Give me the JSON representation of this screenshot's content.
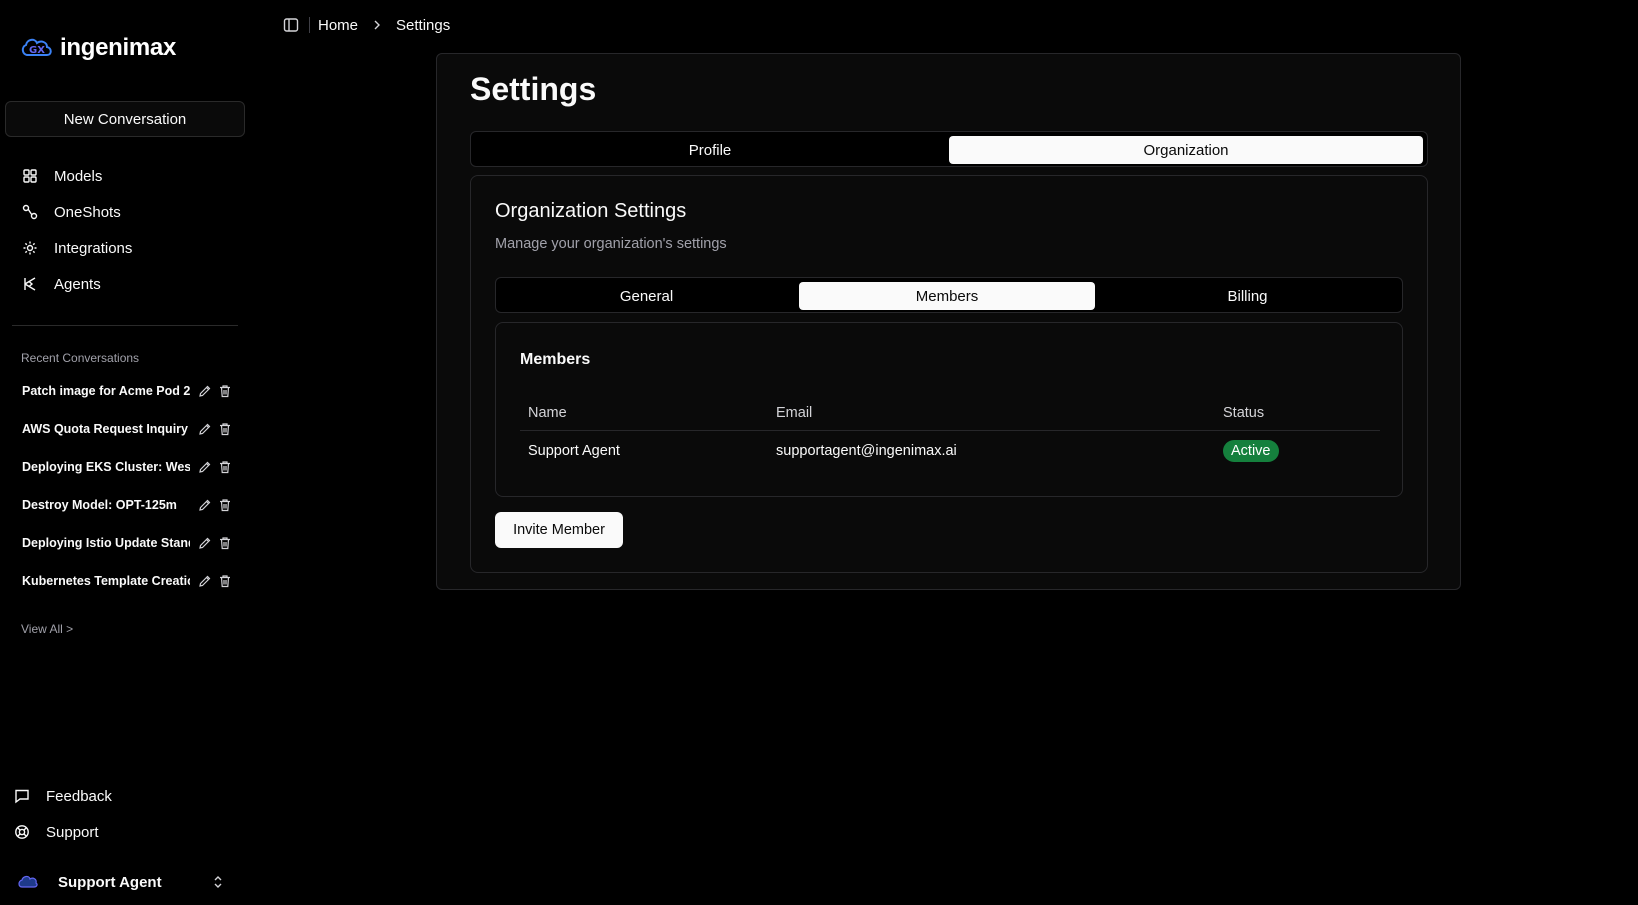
{
  "brand": {
    "name": "ingenimax"
  },
  "sidebar": {
    "new_conversation": "New Conversation",
    "nav": [
      {
        "label": "Models",
        "icon": "models-icon"
      },
      {
        "label": "OneShots",
        "icon": "oneshots-icon"
      },
      {
        "label": "Integrations",
        "icon": "integrations-icon"
      },
      {
        "label": "Agents",
        "icon": "agents-icon"
      }
    ],
    "recent_title": "Recent Conversations",
    "recent": [
      {
        "label": "Patch image for Acme Pod 2"
      },
      {
        "label": "AWS Quota Request Inquiry"
      },
      {
        "label": "Deploying EKS Cluster: West"
      },
      {
        "label": "Destroy Model: OPT-125m"
      },
      {
        "label": "Deploying Istio Update Standard"
      },
      {
        "label": "Kubernetes Template Creation"
      }
    ],
    "view_all": "View All >",
    "bottom": [
      {
        "label": "Feedback",
        "icon": "feedback-icon"
      },
      {
        "label": "Support",
        "icon": "support-icon"
      }
    ],
    "user": {
      "name": "Support Agent"
    }
  },
  "breadcrumb": {
    "home": "Home",
    "current": "Settings"
  },
  "settings": {
    "title": "Settings",
    "tabs": {
      "profile": "Profile",
      "organization": "Organization"
    },
    "active_tab": "Organization",
    "org": {
      "title": "Organization Settings",
      "subtitle": "Manage your organization's settings",
      "tabs": {
        "general": "General",
        "members": "Members",
        "billing": "Billing"
      },
      "active_tab": "Members",
      "members": {
        "title": "Members",
        "columns": {
          "name": "Name",
          "email": "Email",
          "status": "Status"
        },
        "rows": [
          {
            "name": "Support Agent",
            "email": "supportagent@ingenimax.ai",
            "status": "Active"
          }
        ]
      },
      "invite_button": "Invite Member"
    }
  },
  "colors": {
    "active_badge": "#15803d",
    "background": "#000000"
  }
}
